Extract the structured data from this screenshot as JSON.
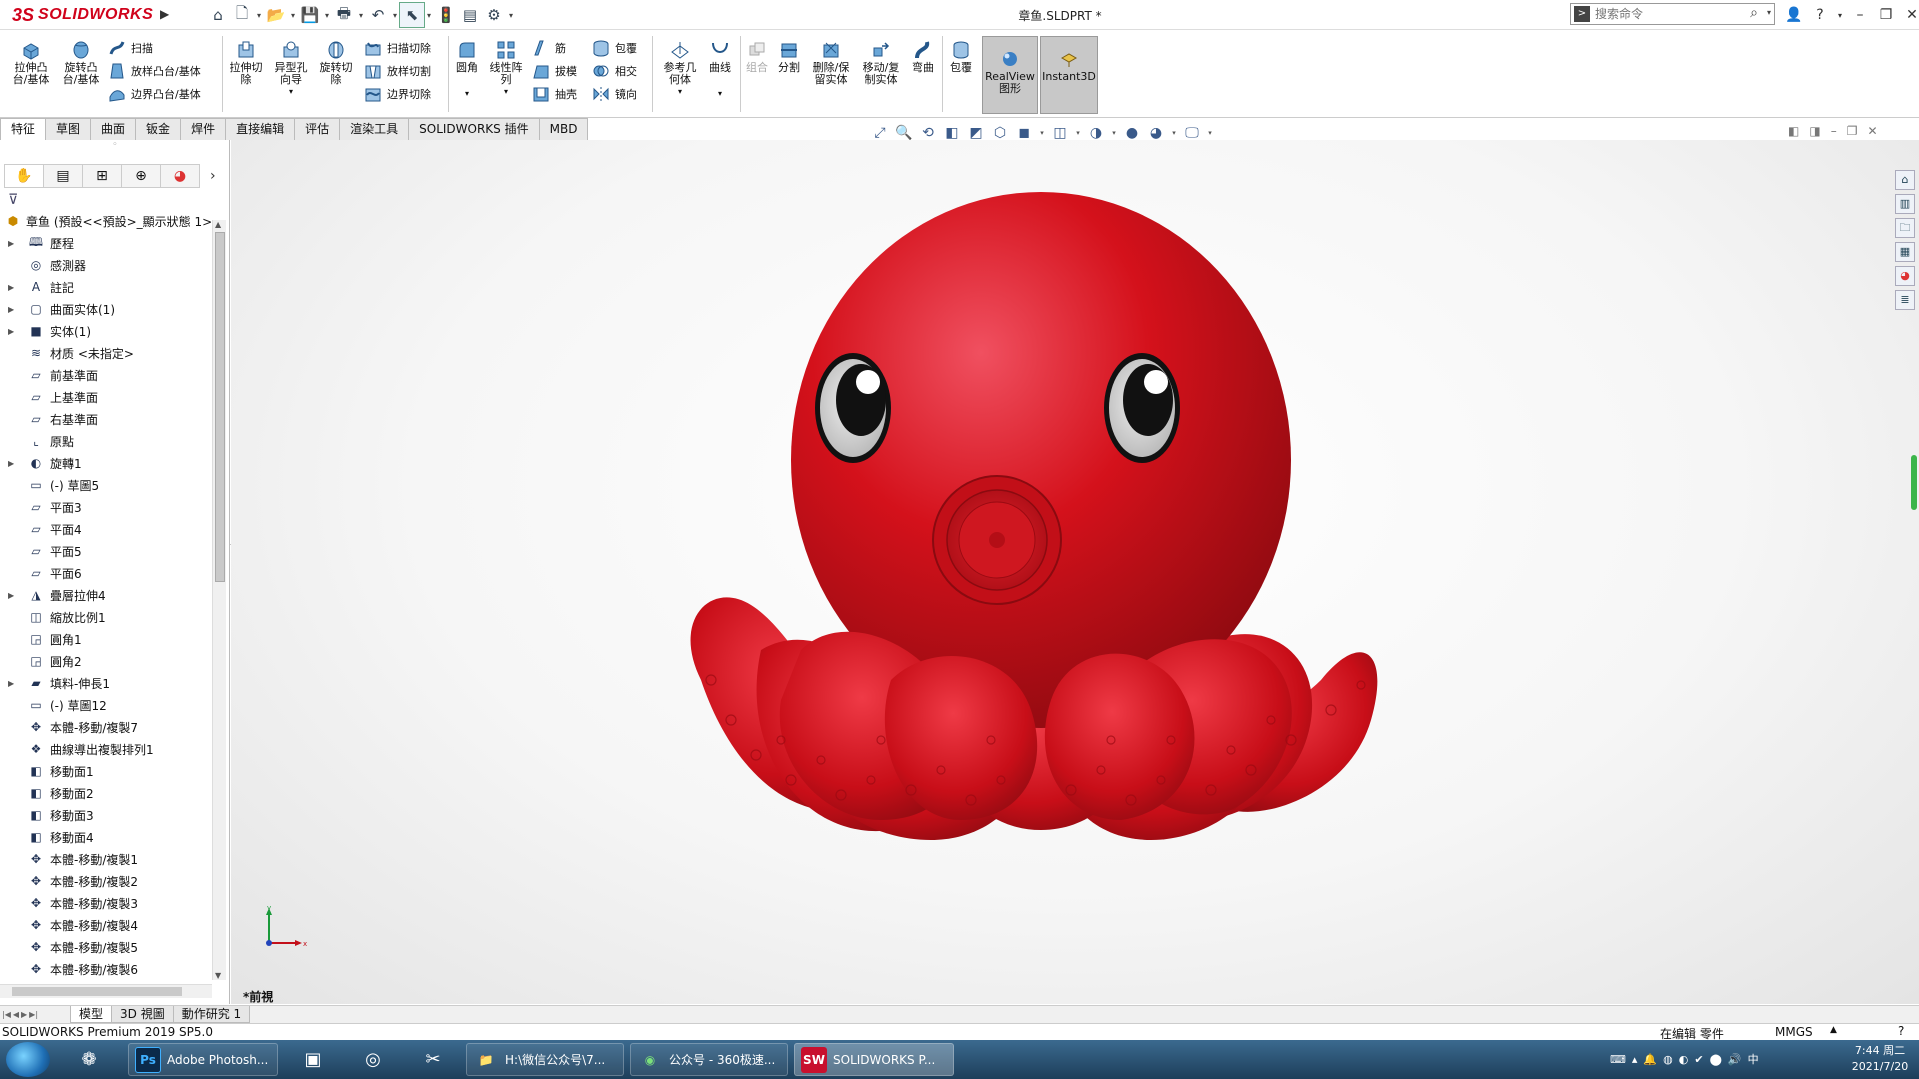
{
  "titlebar": {
    "logo_ds": "3S",
    "logo_text": "SOLIDWORKS",
    "document_title": "章鱼.SLDPRT *",
    "search_placeholder": "搜索命令"
  },
  "commands": {
    "extrude_boss": "拉伸凸\n台/基体",
    "revolve_boss": "旋转凸\n台/基体",
    "sweep": "扫描",
    "loft_boss": "放样凸台/基体",
    "boundary_boss": "边界凸台/基体",
    "extrude_cut": "拉伸切\n除",
    "hole_wizard": "异型孔\n向导",
    "revolve_cut": "旋转切\n除",
    "swept_cut": "扫描切除",
    "lofted_cut": "放样切割",
    "boundary_cut": "边界切除",
    "fillet": "圆角",
    "linear_pattern": "线性阵\n列",
    "rib": "筋",
    "draft": "拔模",
    "shell": "抽壳",
    "wrap": "包覆",
    "intersect": "相交",
    "mirror": "镜向",
    "ref_geometry": "参考几\n何体",
    "curves": "曲线",
    "combine": "组合",
    "split": "分割",
    "delete_keep_body": "删除/保\n留实体",
    "move_copy_body": "移动/复\n制实体",
    "flex": "弯曲",
    "wrap2": "包覆",
    "realview": "RealView\n图形",
    "instant3d": "Instant3D"
  },
  "tabs": [
    "特征",
    "草图",
    "曲面",
    "钣金",
    "焊件",
    "直接编辑",
    "评估",
    "渲染工具",
    "SOLIDWORKS 插件",
    "MBD"
  ],
  "tree": {
    "root": "章鱼  (預設<<預設>_顯示狀態 1>",
    "items": [
      {
        "label": "歷程",
        "expandable": true,
        "icon": "history-icon"
      },
      {
        "label": "感測器",
        "expandable": false,
        "icon": "sensor-icon"
      },
      {
        "label": "註記",
        "expandable": true,
        "icon": "annotation-icon"
      },
      {
        "label": "曲面实体(1)",
        "expandable": true,
        "icon": "surface-bodies-icon"
      },
      {
        "label": "实体(1)",
        "expandable": true,
        "icon": "solid-bodies-icon"
      },
      {
        "label": "材质 <未指定>",
        "expandable": false,
        "icon": "material-icon"
      },
      {
        "label": "前基準面",
        "expandable": false,
        "icon": "plane-icon"
      },
      {
        "label": "上基準面",
        "expandable": false,
        "icon": "plane-icon"
      },
      {
        "label": "右基準面",
        "expandable": false,
        "icon": "plane-icon"
      },
      {
        "label": "原點",
        "expandable": false,
        "icon": "origin-icon"
      },
      {
        "label": "旋轉1",
        "expandable": true,
        "icon": "revolve-icon"
      },
      {
        "label": "(-) 草圖5",
        "expandable": false,
        "icon": "sketch-icon"
      },
      {
        "label": "平面3",
        "expandable": false,
        "icon": "plane-icon"
      },
      {
        "label": "平面4",
        "expandable": false,
        "icon": "plane-icon"
      },
      {
        "label": "平面5",
        "expandable": false,
        "icon": "plane-icon"
      },
      {
        "label": "平面6",
        "expandable": false,
        "icon": "plane-icon"
      },
      {
        "label": "疊層拉伸4",
        "expandable": true,
        "icon": "loft-icon"
      },
      {
        "label": "縮放比例1",
        "expandable": false,
        "icon": "scale-icon"
      },
      {
        "label": "圓角1",
        "expandable": false,
        "icon": "fillet-icon"
      },
      {
        "label": "圓角2",
        "expandable": false,
        "icon": "fillet-icon"
      },
      {
        "label": "填料-伸長1",
        "expandable": true,
        "icon": "extrude-icon"
      },
      {
        "label": "(-) 草圖12",
        "expandable": false,
        "icon": "sketch-icon"
      },
      {
        "label": "本體-移動/複製7",
        "expandable": false,
        "icon": "move-body-icon"
      },
      {
        "label": "曲線導出複製排列1",
        "expandable": false,
        "icon": "curve-pattern-icon"
      },
      {
        "label": "移動面1",
        "expandable": false,
        "icon": "move-face-icon"
      },
      {
        "label": "移動面2",
        "expandable": false,
        "icon": "move-face-icon"
      },
      {
        "label": "移動面3",
        "expandable": false,
        "icon": "move-face-icon"
      },
      {
        "label": "移動面4",
        "expandable": false,
        "icon": "move-face-icon"
      },
      {
        "label": "本體-移動/複製1",
        "expandable": false,
        "icon": "move-body-icon"
      },
      {
        "label": "本體-移動/複製2",
        "expandable": false,
        "icon": "move-body-icon"
      },
      {
        "label": "本體-移動/複製3",
        "expandable": false,
        "icon": "move-body-icon"
      },
      {
        "label": "本體-移動/複製4",
        "expandable": false,
        "icon": "move-body-icon"
      },
      {
        "label": "本體-移動/複製5",
        "expandable": false,
        "icon": "move-body-icon"
      },
      {
        "label": "本體-移動/複製6",
        "expandable": false,
        "icon": "move-body-icon"
      }
    ]
  },
  "viewport": {
    "view_name": "*前視",
    "model_color": "#d4111b"
  },
  "bottom_tabs": [
    "模型",
    "3D 視圖",
    "動作研究 1"
  ],
  "status": {
    "app": "SOLIDWORKS Premium 2019 SP5.0",
    "edit_mode": "在编辑 零件",
    "units": "MMGS"
  },
  "taskbar": {
    "apps": [
      {
        "label": "Adobe Photosh...",
        "abbr": "Ps"
      },
      {
        "label": "H:\\微信公众号\\7...",
        "abbr": "📁"
      },
      {
        "label": "公众号 - 360极速...",
        "abbr": "◉"
      },
      {
        "label": "SOLIDWORKS P...",
        "abbr": "SW"
      }
    ],
    "time": "7:44 周二",
    "date": "2021/7/20"
  }
}
